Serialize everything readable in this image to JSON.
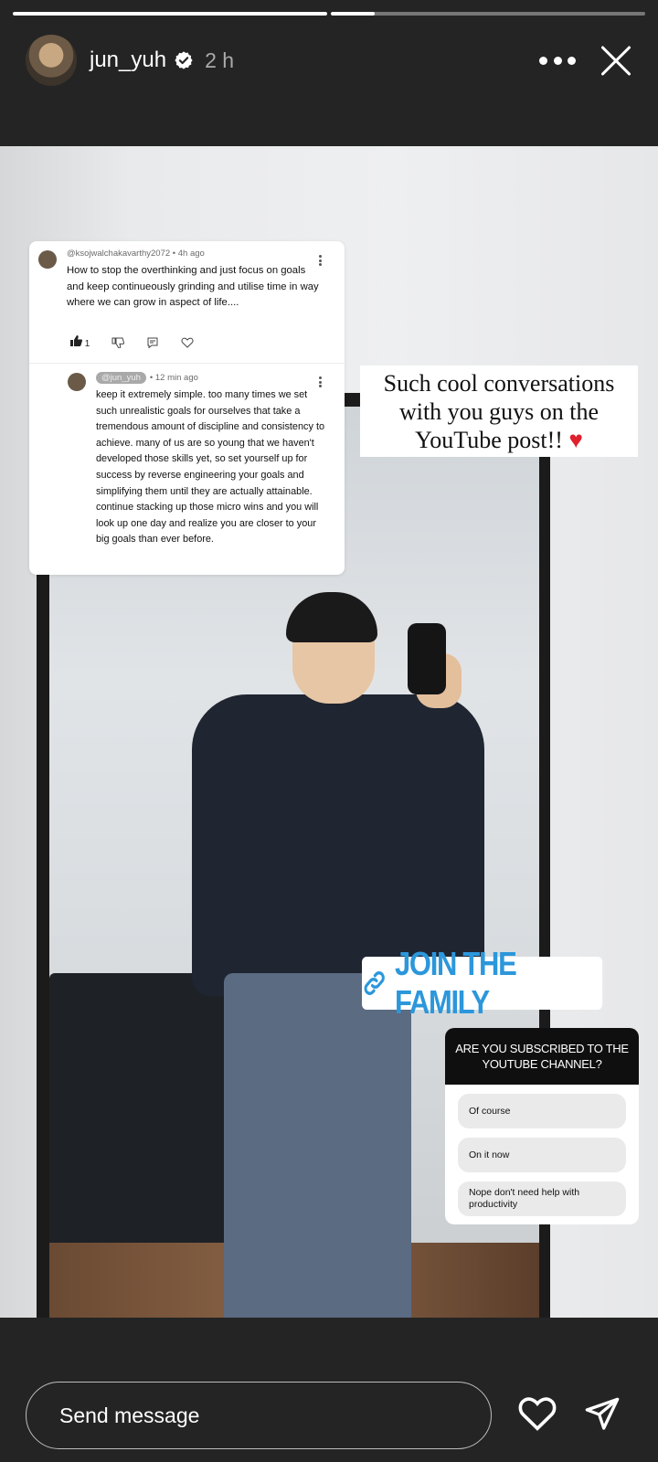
{
  "progress": [
    1.0,
    0.14
  ],
  "header": {
    "username": "jun_yuh",
    "time": "2 h"
  },
  "story": {
    "comment": {
      "original_user": "@ksojwalchakavarthy2072",
      "original_time": "4h ago",
      "original_text": "How to stop the overthinking and just focus on goals and keep continueously grinding and utilise time in way where we can grow in aspect of life....",
      "likes": "1",
      "reply_user": "@jun_yuh",
      "reply_time": "12 min ago",
      "reply_text": "keep it extremely simple. too many times we set such unrealistic goals for ourselves that take a tremendous amount of discipline and consistency to achieve. many of us are so young that we haven't developed those skills yet, so set yourself up for success by reverse engineering your goals and simplifying them until they are actually attainable. continue stacking up those micro wins and you will look up one day and realize you are closer to your big goals than ever before."
    },
    "caption": "Such cool conversations with you guys on the YouTube post!!",
    "caption_heart": "♥",
    "link_label": "JOIN THE FAMILY",
    "poll": {
      "question": "ARE YOU SUBSCRIBED TO THE YOUTUBE CHANNEL?",
      "options": [
        "Of course",
        "On it now",
        "Nope don't need help with productivity"
      ]
    }
  },
  "footer": {
    "message_placeholder": "Send message"
  },
  "colors": {
    "link": "#2c97db",
    "heart": "#e0202c"
  },
  "icons": [
    "verified-badge-icon",
    "more-icon",
    "close-icon",
    "link-icon",
    "heart-icon",
    "send-icon"
  ]
}
